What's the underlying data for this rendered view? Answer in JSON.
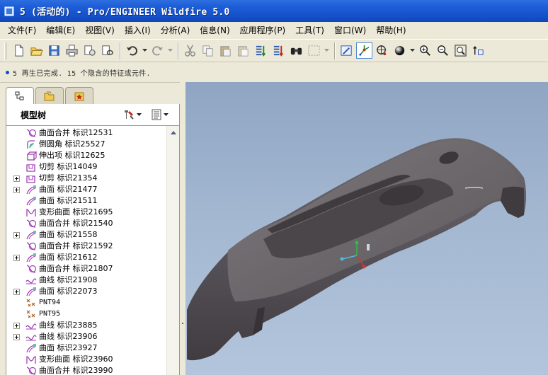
{
  "window": {
    "title": "5 (活动的) - Pro/ENGINEER Wildfire 5.0",
    "title_icon": "window-app-icon"
  },
  "menubar": {
    "items": [
      {
        "label": "文件(F)"
      },
      {
        "label": "编辑(E)"
      },
      {
        "label": "视图(V)"
      },
      {
        "label": "插入(I)"
      },
      {
        "label": "分析(A)"
      },
      {
        "label": "信息(N)"
      },
      {
        "label": "应用程序(P)"
      },
      {
        "label": "工具(T)"
      },
      {
        "label": "窗口(W)"
      },
      {
        "label": "帮助(H)"
      }
    ]
  },
  "toolbar": {
    "icons": [
      "new-icon",
      "open-icon",
      "save-icon",
      "print-icon",
      "send-email-icon",
      "send-link-icon",
      "undo-icon",
      "redo-icon",
      "cut-icon",
      "copy-icon",
      "paste-icon",
      "paste-special-icon",
      "regenerate-icon",
      "regen-manager-icon",
      "find-icon",
      "selection-box-icon",
      "repaint-icon",
      "spin-center-icon",
      "orient-mode-icon",
      "shading-icon",
      "zoom-in-icon",
      "zoom-out-icon",
      "refit-icon",
      "view-manager-icon"
    ],
    "active": "spin-center-icon"
  },
  "message": {
    "text": "5 再生已完成. 15 个隐含的特征或元件."
  },
  "model_tree": {
    "header": "模型树",
    "tabs": [
      "model-tree-tab",
      "folder-browser-tab",
      "favorites-tab"
    ],
    "rows": [
      {
        "label": "曲面合并  标识12531",
        "icon": "merge-icon",
        "expand": false
      },
      {
        "label": "倒圆角  标识25527",
        "icon": "round-icon",
        "expand": false
      },
      {
        "label": "伸出项  标识12625",
        "icon": "protrusion-icon",
        "expand": false
      },
      {
        "label": "切剪  标识14049",
        "icon": "cut-icon",
        "expand": false
      },
      {
        "label": "切剪  标识21354",
        "icon": "cut-icon",
        "expand": true
      },
      {
        "label": "曲面  标识21477",
        "icon": "surface-icon",
        "expand": true
      },
      {
        "label": "曲面  标识21511",
        "icon": "surface-icon",
        "expand": false
      },
      {
        "label": "变形曲面  标识21695",
        "icon": "warp-icon",
        "expand": false
      },
      {
        "label": "曲面合并  标识21540",
        "icon": "merge-icon",
        "expand": false
      },
      {
        "label": "曲面  标识21558",
        "icon": "surface-icon",
        "expand": true
      },
      {
        "label": "曲面合并  标识21592",
        "icon": "merge-icon",
        "expand": false
      },
      {
        "label": "曲面  标识21612",
        "icon": "surface-icon",
        "expand": true
      },
      {
        "label": "曲面合并  标识21807",
        "icon": "merge-icon",
        "expand": false
      },
      {
        "label": "曲线  标识21908",
        "icon": "curve-icon",
        "expand": false
      },
      {
        "label": "曲面  标识22073",
        "icon": "surface-icon",
        "expand": true
      },
      {
        "label": "PNT94",
        "icon": "datum-point-icon",
        "expand": false
      },
      {
        "label": "PNT95",
        "icon": "datum-point-icon",
        "expand": false
      },
      {
        "label": "曲线  标识23885",
        "icon": "curve-icon",
        "expand": true
      },
      {
        "label": "曲线  标识23906",
        "icon": "curve-icon",
        "expand": true
      },
      {
        "label": "曲面  标识23927",
        "icon": "surface-icon",
        "expand": false
      },
      {
        "label": "变形曲面  标识23960",
        "icon": "warp-icon",
        "expand": false
      },
      {
        "label": "曲面合并  标识23990",
        "icon": "merge-icon",
        "expand": false
      }
    ]
  },
  "colors": {
    "title_bar": "#1d5ed8",
    "viewport_top": "#8fa5c3",
    "viewport_bottom": "#b3c5dc",
    "model": "#5a5659",
    "tree_icon": "#a13db5"
  }
}
